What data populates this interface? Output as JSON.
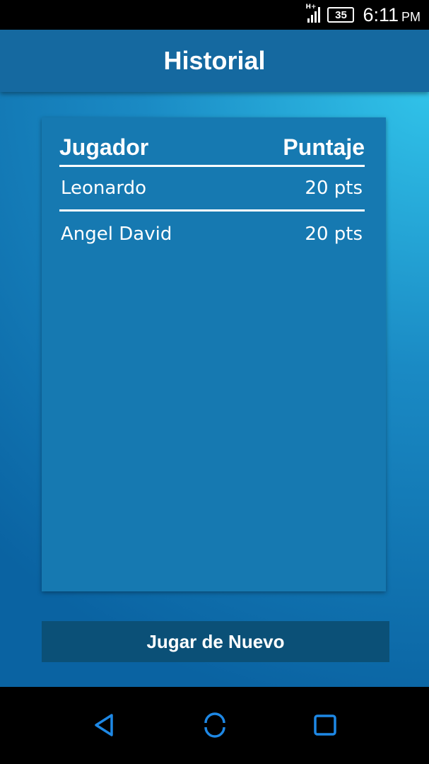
{
  "status_bar": {
    "network": "H+",
    "battery": "35",
    "time": "6:11",
    "ampm": "PM"
  },
  "header": {
    "title": "Historial"
  },
  "table": {
    "col_player": "Jugador",
    "col_score": "Puntaje",
    "rows": [
      {
        "player": "Leonardo",
        "score": "20 pts"
      },
      {
        "player": "Angel David",
        "score": "20 pts"
      }
    ]
  },
  "actions": {
    "play_again": "Jugar de Nuevo"
  },
  "nav": {
    "icons": [
      "back-icon",
      "home-icon",
      "recent-apps-icon"
    ],
    "icon_color": "#1e88e5"
  },
  "colors": {
    "header_bg": "#1569a0",
    "card_bg": "#1679b1",
    "button_bg": "#0b5077"
  }
}
